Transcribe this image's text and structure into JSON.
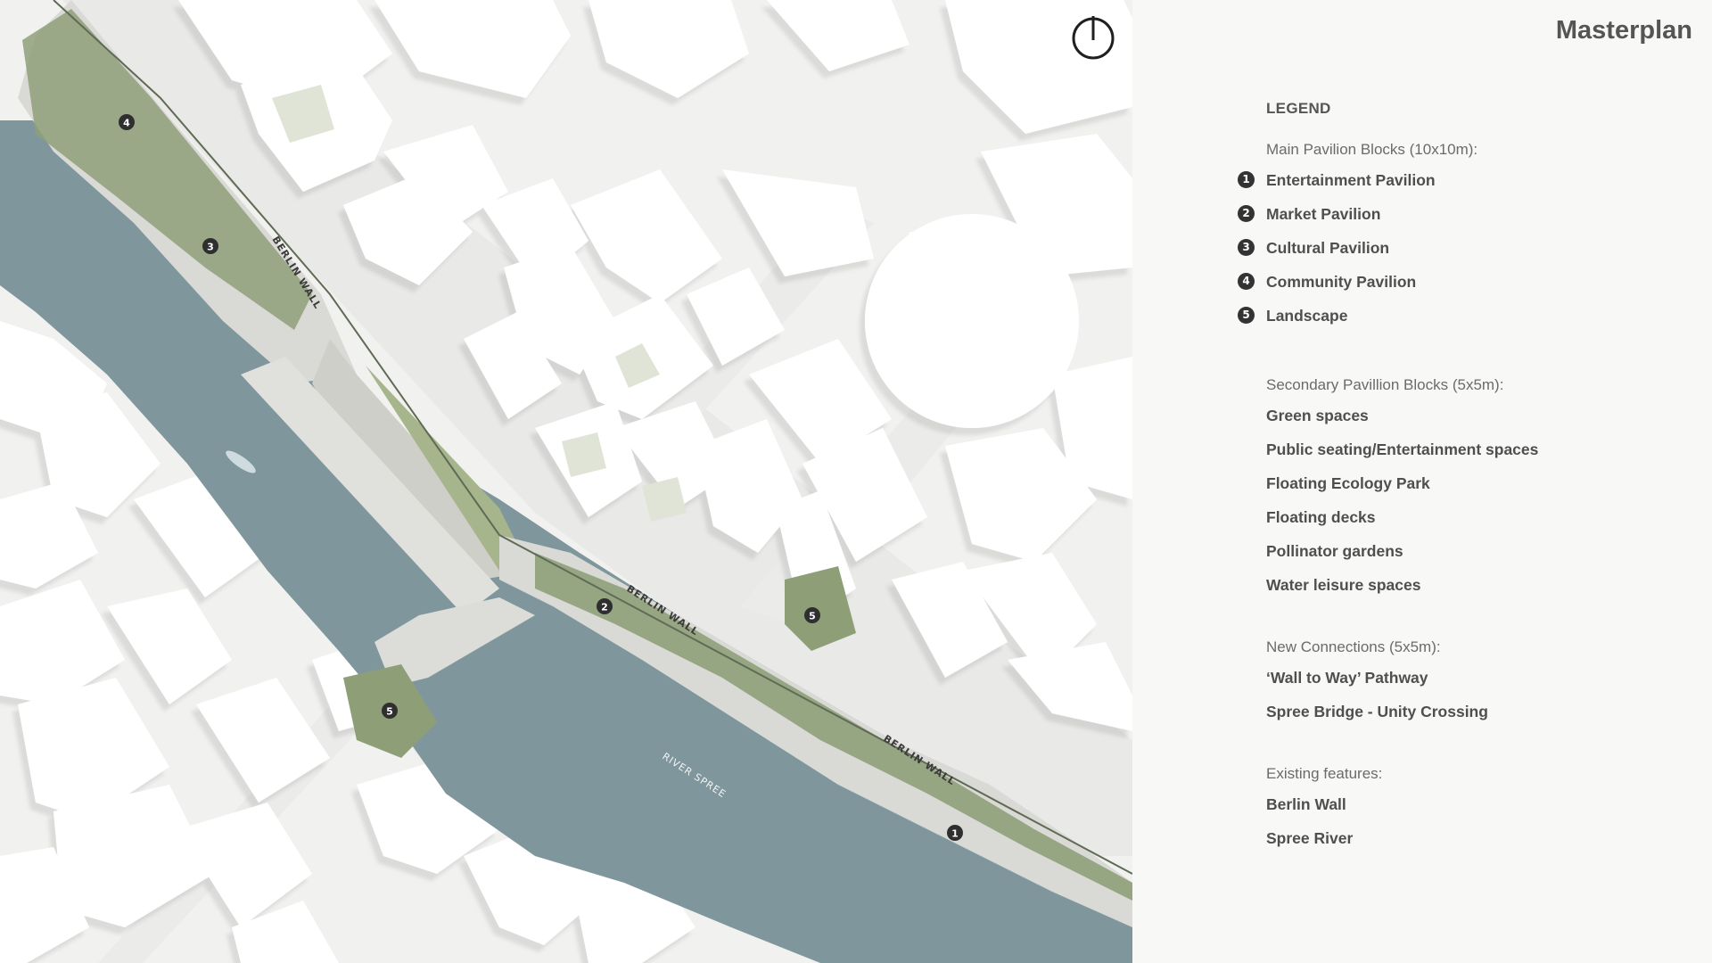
{
  "title": "Masterplan",
  "map": {
    "north_arrow_icon": "north-arrow-icon",
    "labels": {
      "berlin_wall": "BERLIN WALL",
      "river": "RIVER SPREE"
    },
    "markers": [
      "1",
      "2",
      "3",
      "4",
      "5"
    ]
  },
  "legend": {
    "heading": "LEGEND",
    "main": {
      "title": "Main Pavilion Blocks (10x10m):",
      "items": [
        {
          "num": "1",
          "label": "Entertainment Pavilion"
        },
        {
          "num": "2",
          "label": "Market Pavilion"
        },
        {
          "num": "3",
          "label": "Cultural Pavilion"
        },
        {
          "num": "4",
          "label": "Community Pavilion"
        },
        {
          "num": "5",
          "label": "Landscape"
        }
      ]
    },
    "secondary": {
      "title": "Secondary Pavillion Blocks (5x5m):",
      "items": [
        "Green spaces",
        "Public seating/Entertainment spaces",
        "Floating Ecology Park",
        "Floating decks",
        "Pollinator gardens",
        "Water leisure spaces"
      ]
    },
    "connections": {
      "title": "New Connections (5x5m):",
      "items": [
        "‘Wall to Way’ Pathway",
        "Spree Bridge - Unity Crossing"
      ]
    },
    "existing": {
      "title": "Existing features:",
      "items": [
        "Berlin Wall",
        "Spree River"
      ]
    }
  },
  "colors": {
    "water": "#7f979c",
    "green": "#7f9467",
    "green_light": "#b6c59c",
    "building": "#ffffff",
    "ground": "#f1f1ef",
    "marker": "#2f2f2f"
  }
}
